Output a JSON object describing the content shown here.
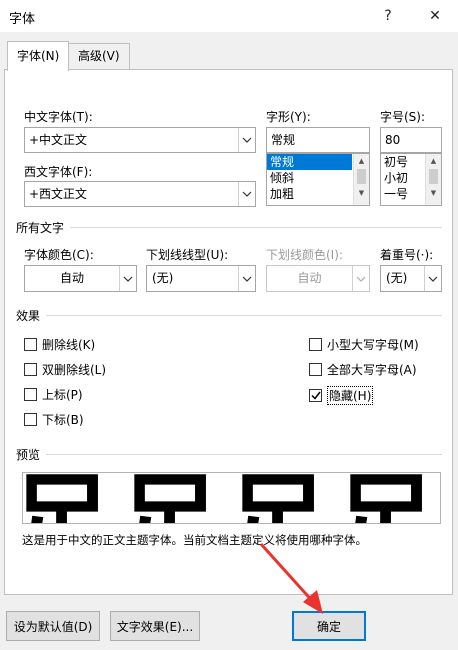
{
  "window": {
    "title": "字体",
    "help": "?",
    "close": "✕"
  },
  "tabs": [
    {
      "label": "字体(N)"
    },
    {
      "label": "高级(V)"
    }
  ],
  "font": {
    "chinese_label": "中文字体(T):",
    "chinese_value": "+中文正文",
    "western_label": "西文字体(F):",
    "western_value": "+西文正文",
    "style_label": "字形(Y):",
    "style_value": "常规",
    "style_options": [
      "常规",
      "倾斜",
      "加粗"
    ],
    "size_label": "字号(S):",
    "size_value": "80",
    "size_options": [
      "初号",
      "小初",
      "一号"
    ]
  },
  "all_text": {
    "section": "所有文字",
    "color_label": "字体颜色(C):",
    "color_value": "自动",
    "underline_style_label": "下划线线型(U):",
    "underline_style_value": "(无)",
    "underline_color_label": "下划线颜色(I):",
    "underline_color_value": "自动",
    "emphasis_label": "着重号(·):",
    "emphasis_value": "(无)"
  },
  "effects": {
    "section": "效果",
    "strikethrough": "删除线(K)",
    "double_strikethrough": "双删除线(L)",
    "superscript": "上标(P)",
    "subscript": "下标(B)",
    "small_caps": "小型大写字母(M)",
    "all_caps": "全部大写字母(A)",
    "hidden": "隐藏(H)",
    "hidden_checked": true
  },
  "preview": {
    "section": "预览",
    "glyph": "足",
    "description": "这是用于中文的正文主题字体。当前文档主题定义将使用哪种字体。"
  },
  "buttons": {
    "set_default": "设为默认值(D)",
    "text_effects": "文字效果(E)...",
    "ok": "确定"
  }
}
